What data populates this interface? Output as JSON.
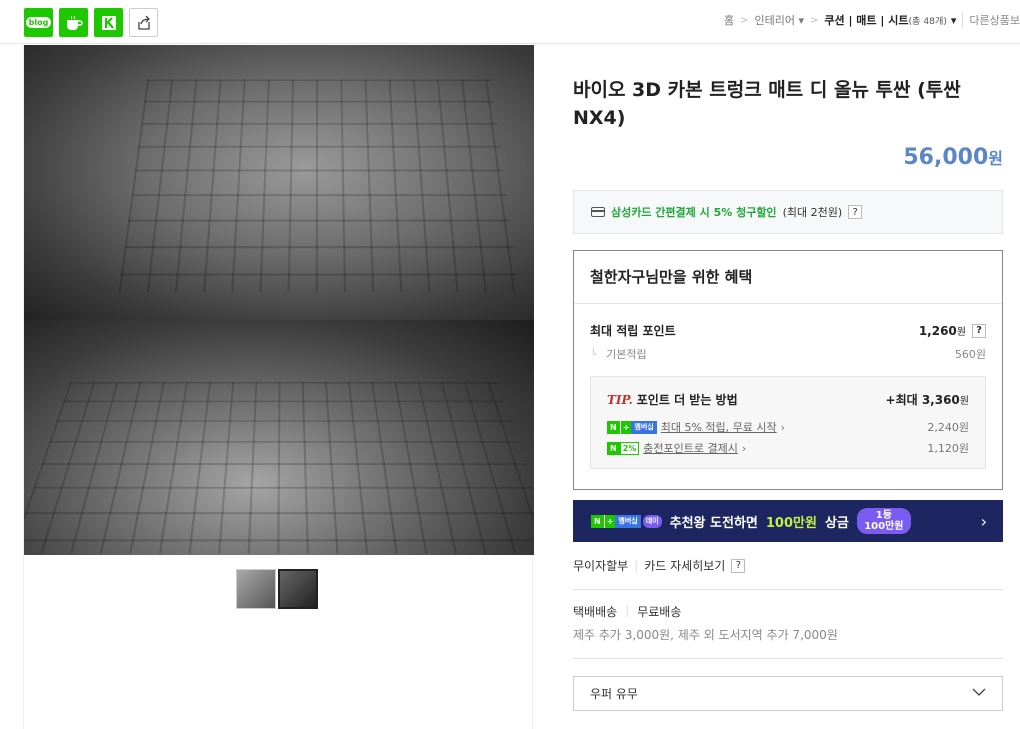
{
  "share": {
    "blog_label": "blog"
  },
  "breadcrumb": {
    "home": "홈",
    "interior": "인테리어",
    "current": "쿠션 | 매트 | 시트",
    "count": "(총 48개)",
    "other": "다른상품보"
  },
  "product": {
    "title": "바이오 3D 카본 트렁크 매트 디 올뉴 투싼 (투싼NX4)",
    "price": "56,000",
    "price_unit": "원"
  },
  "card_promo": {
    "highlight": "삼성카드 간편결제 시 5% 청구할인",
    "detail": "(최대 2천원)",
    "help": "?"
  },
  "benefit": {
    "title": "철한자구님만을 위한 혜택",
    "max_label": "최대 적립 포인트",
    "max_value": "1,260",
    "max_unit": "원",
    "base_label": "기본적립",
    "base_value": "560원",
    "tip_word": "TIP.",
    "tip_label": "포인트 더 받는 방법",
    "tip_total": "+최대 3,360",
    "tip_unit": "원",
    "rows": [
      {
        "badge_n": "N",
        "badge_extra": "+",
        "badge_mem": "멤버십",
        "link": "최대 5% 적립, 무료 시작",
        "value": "2,240원"
      },
      {
        "badge_n": "N",
        "badge_extra": "2%",
        "link": "충전포인트로 결제시",
        "value": "1,120원"
      }
    ]
  },
  "banner": {
    "badge_mem": "멤버십",
    "badge_extra": "데이",
    "text_a": "추천왕 도전하면",
    "text_hl": "100만원",
    "text_b": "상금",
    "pill_top": "1등",
    "pill_bottom": "100만원",
    "chevron": "›"
  },
  "installment": {
    "label": "무이자할부",
    "detail": "카드 자세히보기",
    "help": "?"
  },
  "shipping": {
    "type": "택배배송",
    "fee": "무료배송",
    "extra": "제주 추가 3,000원, 제주 외 도서지역 추가 7,000원"
  },
  "option": {
    "label": "우퍼 유무"
  },
  "colors": {
    "price": "#5a87c9",
    "green": "#1ea838",
    "banner_bg": "#1d2660",
    "tip_red": "#c0312b"
  }
}
